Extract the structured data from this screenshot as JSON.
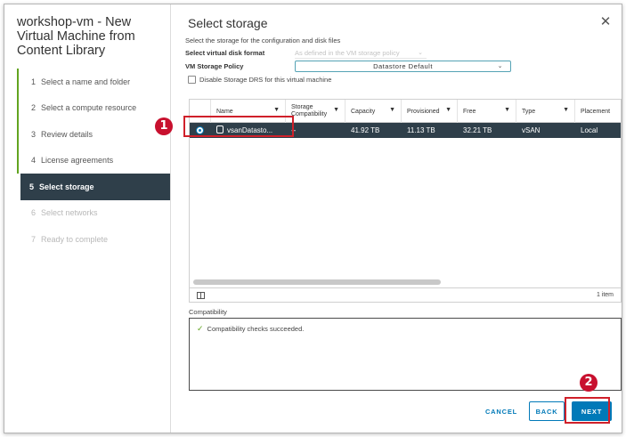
{
  "wizard": {
    "title": "workshop-vm - New Virtual Machine from Content Library",
    "steps": [
      {
        "num": "1",
        "label": "Select a name and folder"
      },
      {
        "num": "2",
        "label": "Select a compute resource"
      },
      {
        "num": "3",
        "label": "Review details"
      },
      {
        "num": "4",
        "label": "License agreements"
      },
      {
        "num": "5",
        "label": "Select storage"
      },
      {
        "num": "6",
        "label": "Select networks"
      },
      {
        "num": "7",
        "label": "Ready to complete"
      }
    ]
  },
  "main": {
    "title": "Select storage",
    "close_glyph": "✕",
    "subtitle": "Select the storage for the configuration and disk files",
    "disk_format_label": "Select virtual disk format",
    "disk_format_value": "As defined in the VM storage policy",
    "policy_label": "VM Storage Policy",
    "policy_value": "Datastore Default",
    "disable_drs_label": "Disable Storage DRS for this virtual machine"
  },
  "grid": {
    "columns": [
      "Name",
      "Storage Compatibility",
      "Capacity",
      "Provisioned",
      "Free",
      "Type",
      "Placement"
    ],
    "rows": [
      {
        "name": "vsanDatasto...",
        "compat": "--",
        "capacity": "41.92 TB",
        "provisioned": "11.13 TB",
        "free": "32.21 TB",
        "type": "vSAN",
        "placement": "Local"
      }
    ],
    "item_count": "1 item",
    "filter_glyph": "▼"
  },
  "compatibility": {
    "label": "Compatibility",
    "message": "Compatibility checks succeeded."
  },
  "buttons": {
    "cancel": "CANCEL",
    "back": "BACK",
    "next": "NEXT"
  },
  "annotations": {
    "badge1": "1",
    "badge2": "2",
    "color": "#d0202a"
  }
}
